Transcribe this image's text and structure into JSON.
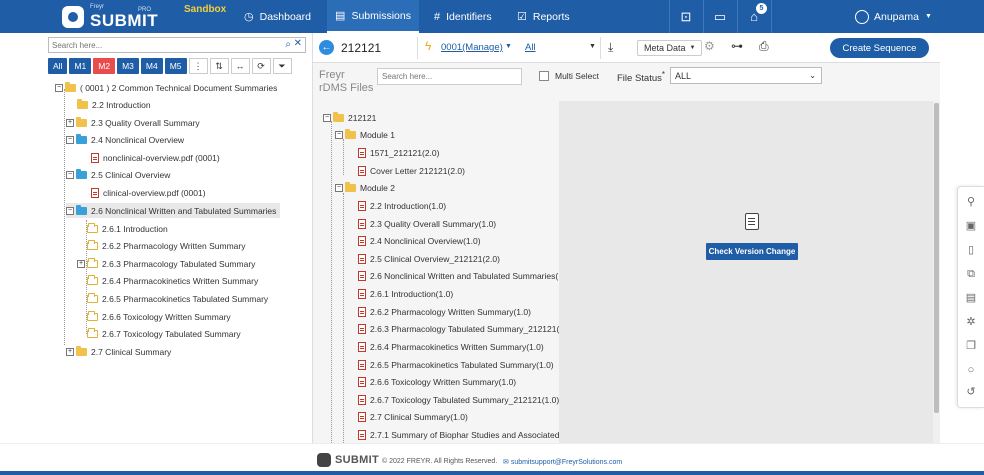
{
  "header": {
    "brand_small": "Freyr",
    "brand": "SUBMIT",
    "brand_pro": "PRO",
    "environment": "Sandbox",
    "nav": [
      {
        "label": "Dashboard",
        "icon": "dashboard-icon"
      },
      {
        "label": "Submissions",
        "icon": "submissions-icon",
        "active": true
      },
      {
        "label": "Identifiers",
        "icon": "hash-icon"
      },
      {
        "label": "Reports",
        "icon": "reports-icon"
      }
    ],
    "notification_count": "5",
    "user_name": "Anupama"
  },
  "left_panel": {
    "search_placeholder": "Search here...",
    "module_buttons": [
      "All",
      "M1",
      "M2",
      "M3",
      "M4",
      "M5"
    ],
    "active_module": "M2",
    "tree": [
      {
        "label": "( 0001 ) 2 Common Technical Document Summaries",
        "type": "folder"
      },
      {
        "label": "2.2 Introduction",
        "type": "folder"
      },
      {
        "label": "2.3 Quality Overall Summary",
        "type": "folder"
      },
      {
        "label": "2.4 Nonclinical Overview",
        "type": "folder-open"
      },
      {
        "label": "nonclinical-overview.pdf (0001)",
        "type": "pdf"
      },
      {
        "label": "2.5 Clinical Overview",
        "type": "folder-open"
      },
      {
        "label": "clinical-overview.pdf (0001)",
        "type": "pdf"
      },
      {
        "label": "2.6 Nonclinical Written and Tabulated Summaries",
        "type": "folder-open",
        "selected": true
      },
      {
        "label": "2.6.1 Introduction",
        "type": "folder-empty"
      },
      {
        "label": "2.6.2 Pharmacology Written Summary",
        "type": "folder-empty"
      },
      {
        "label": "2.6.3 Pharmacology Tabulated Summary",
        "type": "folder-empty"
      },
      {
        "label": "2.6.4 Pharmacokinetics Written Summary",
        "type": "folder-empty"
      },
      {
        "label": "2.6.5 Pharmacokinetics Tabulated Summary",
        "type": "folder-empty"
      },
      {
        "label": "2.6.6 Toxicology Written Summary",
        "type": "folder-empty"
      },
      {
        "label": "2.6.7 Toxicology Tabulated Summary",
        "type": "folder-empty"
      },
      {
        "label": "2.7 Clinical Summary",
        "type": "folder"
      }
    ]
  },
  "toolbar": {
    "sequence": "212121",
    "manage_link": "0001(Manage)",
    "all_link": "All",
    "meta_data": "Meta Data",
    "create_sequence": "Create Sequence"
  },
  "filter": {
    "rdms_line1": "Freyr",
    "rdms_line2": "rDMS Files",
    "search_placeholder": "Search here...",
    "multi_select": "Multi Select",
    "file_status_label": "File Status",
    "file_status_required": "*",
    "file_status_value": "ALL"
  },
  "file_tree": [
    {
      "label": "212121",
      "type": "folder"
    },
    {
      "label": "Module 1",
      "type": "folder"
    },
    {
      "label": "1571_212121(2.0)",
      "type": "pdf"
    },
    {
      "label": "Cover Letter 212121(2.0)",
      "type": "pdf"
    },
    {
      "label": "Module 2",
      "type": "folder"
    },
    {
      "label": "2.2 Introduction(1.0)",
      "type": "pdf"
    },
    {
      "label": "2.3 Quality Overall Summary(1.0)",
      "type": "pdf"
    },
    {
      "label": "2.4 Nonclinical Overview(1.0)",
      "type": "pdf"
    },
    {
      "label": "2.5 Clinical Overview_212121(2.0)",
      "type": "pdf"
    },
    {
      "label": "2.6 Nonclinical Written and Tabulated Summaries(",
      "type": "pdf"
    },
    {
      "label": "2.6.1 Introduction(1.0)",
      "type": "pdf"
    },
    {
      "label": "2.6.2 Pharmacology Written Summary(1.0)",
      "type": "pdf"
    },
    {
      "label": "2.6.3 Pharmacology Tabulated Summary_212121(",
      "type": "pdf"
    },
    {
      "label": "2.6.4 Pharmacokinetics Written Summary(1.0)",
      "type": "pdf"
    },
    {
      "label": "2.6.5 Pharmacokinetics Tabulated Summary(1.0)",
      "type": "pdf"
    },
    {
      "label": "2.6.6 Toxicology Written Summary(1.0)",
      "type": "pdf"
    },
    {
      "label": "2.6.7 Toxicology Tabulated Summary_212121(1.0)",
      "type": "pdf"
    },
    {
      "label": "2.7 Clinical Summary(1.0)",
      "type": "pdf"
    },
    {
      "label": "2.7.1 Summary of Biophar Studies and Associated",
      "type": "pdf"
    }
  ],
  "version_panel": {
    "check_version_change": "Check Version Change"
  },
  "footer": {
    "brand_small": "Freyr",
    "brand": "SUBMIT",
    "brand_pro": "PRO",
    "copyright": "© 2022 FREYR. All Rights Reserved.",
    "email": "submitsupport@FreyrSolutions.com"
  },
  "colors": {
    "primary": "#1f5da6",
    "accent_red": "#e84c4c",
    "sandbox": "#f2d03b",
    "folder": "#f0c14b",
    "folder_open": "#3aa0d8"
  }
}
